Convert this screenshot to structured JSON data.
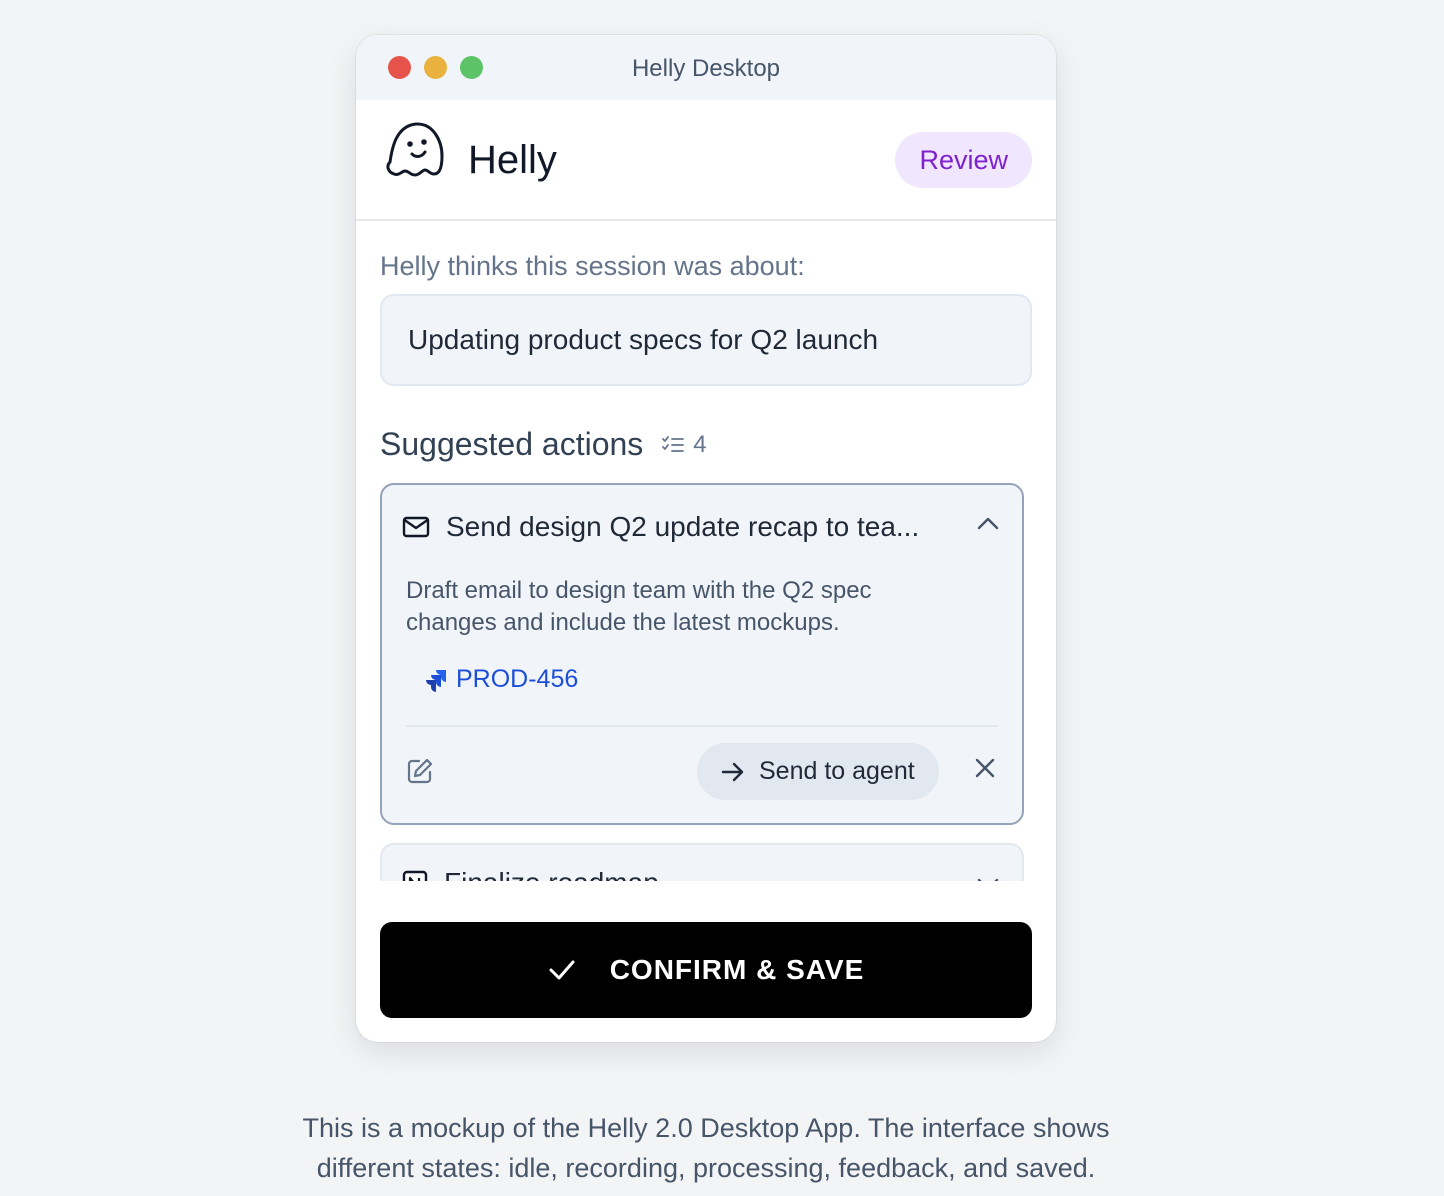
{
  "window": {
    "title": "Helly Desktop"
  },
  "header": {
    "app_name": "Helly",
    "status_badge": "Review"
  },
  "session": {
    "label": "Helly thinks this session was about:",
    "summary": "Updating product specs for Q2 launch"
  },
  "actions": {
    "title": "Suggested actions",
    "count": "4",
    "items": [
      {
        "title": "Send design Q2 update recap to tea...",
        "icon": "mail-icon",
        "description": "Draft email to design team with the Q2 spec changes and include the latest mockups.",
        "ticket": "PROD-456",
        "send_label": "Send to agent"
      },
      {
        "title": "Finalize roadmap",
        "icon": "notion-icon"
      }
    ]
  },
  "confirm_label": "CONFIRM & SAVE",
  "caption": {
    "line1": "This is a mockup of the Helly 2.0 Desktop App. The interface shows",
    "line2": "different states: idle, recording, processing, feedback, and saved."
  },
  "colors": {
    "badge_bg": "#f0e6fd",
    "badge_text": "#7e22ce",
    "ticket_link": "#1d4ed8",
    "confirm_bg": "#000000"
  }
}
